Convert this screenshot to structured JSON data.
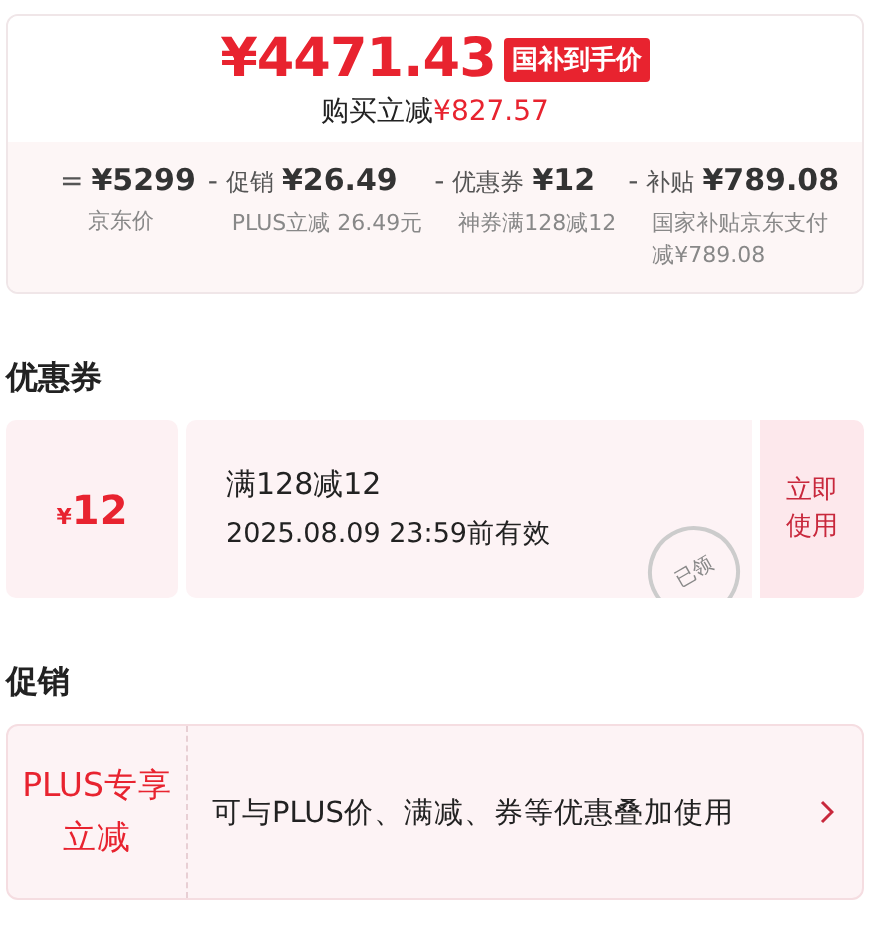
{
  "price": {
    "amount": "¥4471.43",
    "badge": "国补到手价",
    "saving_label": "购买立减",
    "saving_amount": "¥827.57"
  },
  "breakdown": [
    {
      "operator": "=",
      "amount": "¥5299",
      "note": "京东价"
    },
    {
      "operator": "-",
      "label": "促销",
      "amount": "¥26.49",
      "note": "PLUS立减 26.49元"
    },
    {
      "operator": "-",
      "label": "优惠券",
      "amount": "¥12",
      "note": "神券满128减12"
    },
    {
      "operator": "-",
      "label": "补贴",
      "amount": "¥789.08",
      "note": "国家补贴京东支付减¥789.08"
    }
  ],
  "coupon_section": {
    "title": "优惠券",
    "coupons": [
      {
        "currency": "¥",
        "amount": "12",
        "condition": "满128减12",
        "validity": "2025.08.09 23:59前有效",
        "action": "立即使用",
        "claimed": true,
        "stamp": "已领"
      }
    ]
  },
  "promo_section": {
    "title": "促销",
    "items": [
      {
        "tag": "PLUS专享立减",
        "description": "可与PLUS价、满减、券等优惠叠加使用"
      }
    ]
  }
}
